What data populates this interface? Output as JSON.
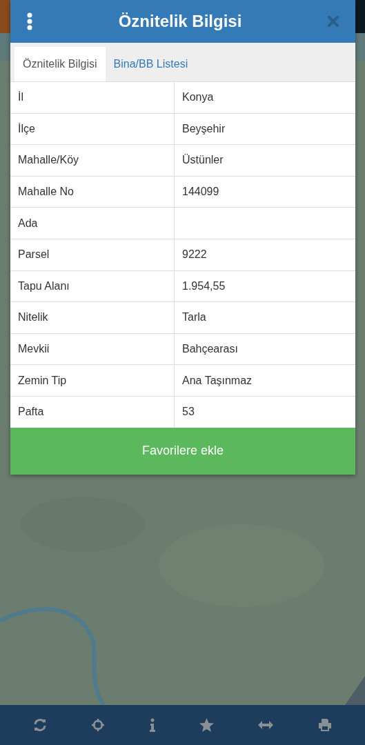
{
  "dialog": {
    "title": "Öznitelik Bilgisi"
  },
  "tabs": [
    {
      "label": "Öznitelik Bilgisi",
      "selected": true
    },
    {
      "label": "Bina/BB Listesi",
      "selected": false
    }
  ],
  "rows": [
    {
      "label": "İl",
      "value": "Konya"
    },
    {
      "label": "İlçe",
      "value": "Beyşehir"
    },
    {
      "label": "Mahalle/Köy",
      "value": "Üstünler"
    },
    {
      "label": "Mahalle No",
      "value": "144099"
    },
    {
      "label": "Ada"
    },
    {
      "label": "Parsel",
      "value": "9222"
    },
    {
      "label": "Tapu Alanı",
      "value": "1.954,55"
    },
    {
      "label": "Nitelik",
      "value": "Tarla"
    },
    {
      "label": "Mevkii",
      "value": "Bahçearası"
    },
    {
      "label": "Zemin Tip",
      "value": "Ana Taşınmaz"
    },
    {
      "label": "Pafta",
      "value": "53"
    }
  ],
  "action_button": "Favorilere ekle"
}
